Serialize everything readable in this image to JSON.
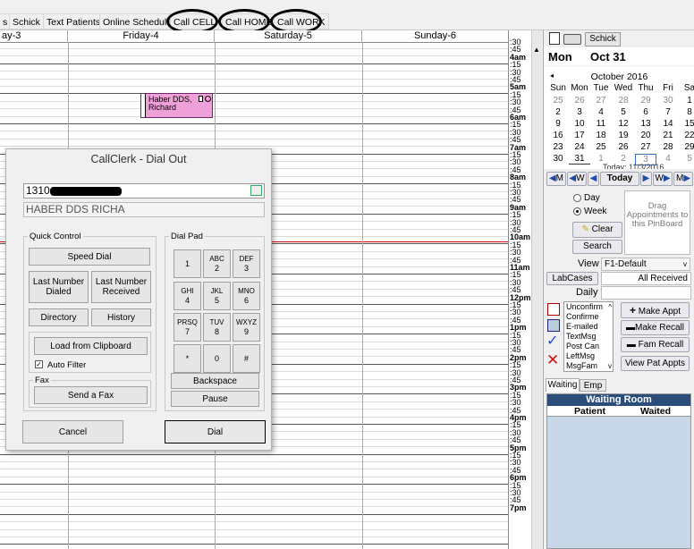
{
  "toolbar": {
    "items": [
      "s",
      "Schick",
      "Text Patients",
      "Online Schedule",
      "Call  CELL",
      "Call HOME",
      "Call WORK"
    ]
  },
  "days": [
    "ay-3",
    "Friday-4",
    "Saturday-5",
    "Sunday-6"
  ],
  "time_rows": [
    {
      "hour": "4am",
      "q": [
        ":15",
        ":30",
        ":45"
      ]
    },
    {
      "hour": "5am",
      "q": [
        ":15",
        ":30",
        ":45"
      ]
    },
    {
      "hour": "6am",
      "q": [
        ":15",
        ":30",
        ":45"
      ]
    },
    {
      "hour": "7am",
      "q": [
        ":15",
        ":30",
        ":45"
      ]
    },
    {
      "hour": "8am",
      "q": [
        ":15",
        ":30",
        ":45"
      ]
    },
    {
      "hour": "9am",
      "q": [
        ":15",
        ":30",
        ":45"
      ]
    },
    {
      "hour": "10am",
      "q": [
        ":15",
        ":30",
        ":45"
      ]
    },
    {
      "hour": "11am",
      "q": [
        ":15",
        ":30",
        ":45"
      ]
    },
    {
      "hour": "12pm",
      "q": [
        ":15",
        ":30",
        ":45"
      ]
    },
    {
      "hour": "1pm",
      "q": [
        ":15",
        ":30",
        ":45"
      ]
    },
    {
      "hour": "2pm",
      "q": [
        ":15",
        ":30",
        ":45"
      ]
    },
    {
      "hour": "3pm",
      "q": [
        ":15",
        ":30",
        ":45"
      ]
    },
    {
      "hour": "4pm",
      "q": [
        ":15",
        ":30",
        ":45"
      ]
    },
    {
      "hour": "5pm",
      "q": [
        ":15",
        ":30",
        ":45"
      ]
    },
    {
      "hour": "6pm",
      "q": [
        ":15",
        ":30",
        ":45"
      ]
    },
    {
      "hour": "7pm",
      "q": []
    }
  ],
  "time_top": [
    ":30",
    ":45"
  ],
  "appointment": {
    "line1": "Haber DDS,",
    "line2": "Richard",
    "color": "#f0a0d8"
  },
  "right_panel": {
    "provider_tab": "Schick",
    "date_day": "Mon",
    "date": "Oct 31",
    "month_title": "October 2016",
    "weekdays": [
      "Sun",
      "Mon",
      "Tue",
      "Wed",
      "Thu",
      "Fri",
      "Sa"
    ],
    "weeks": [
      [
        "25",
        "26",
        "27",
        "28",
        "29",
        "30",
        "1"
      ],
      [
        "2",
        "3",
        "4",
        "5",
        "6",
        "7",
        "8"
      ],
      [
        "9",
        "10",
        "11",
        "12",
        "13",
        "14",
        "15"
      ],
      [
        "16",
        "17",
        "18",
        "19",
        "20",
        "21",
        "22"
      ],
      [
        "23",
        "24",
        "25",
        "26",
        "27",
        "28",
        "29"
      ],
      [
        "30",
        "31",
        "1",
        "2",
        "3",
        "4",
        "5"
      ]
    ],
    "today_partial": "Today: 11/3/2016",
    "nav": {
      "m_back": "M",
      "w_back": "W",
      "today": "Today",
      "w_fwd": "W",
      "m_fwd": "M"
    },
    "view_day": "Day",
    "view_week": "Week",
    "clear": "Clear",
    "search": "Search",
    "pinboard": "Drag Appointments to this PinBoard",
    "view_label": "View",
    "view_value": "F1-Default",
    "labcases": "LabCases",
    "all_received": "All Received",
    "daily": "Daily",
    "status_list": [
      "Unconfirm",
      "Confirme",
      "E-mailed",
      "TextMsg",
      "Post Can",
      "LeftMsg",
      "MsgFam"
    ],
    "make_appt": "Make Appt",
    "make_recall": "Make Recall",
    "fam_recall": "Fam Recall",
    "view_pat_appts": "View Pat Appts",
    "tab_waiting": "Waiting",
    "tab_emp": "Emp",
    "waiting_room_title": "Waiting Room",
    "col_patient": "Patient",
    "col_waited": "Waited"
  },
  "dialog": {
    "title": "CallClerk - Dial Out",
    "number": "1310",
    "name": "HABER DDS RICHA",
    "quick_control": "Quick Control",
    "dial_pad": "Dial Pad",
    "speed_dial": "Speed Dial",
    "last_dialed": "Last Number Dialed",
    "last_received": "Last Number Received",
    "directory": "Directory",
    "history": "History",
    "load_clipboard": "Load from Clipboard",
    "auto_filter": "Auto Filter",
    "fax": "Fax",
    "send_fax": "Send a Fax",
    "backspace": "Backspace",
    "pause": "Pause",
    "cancel": "Cancel",
    "dial": "Dial",
    "keys": [
      {
        "l": "",
        "n": "1"
      },
      {
        "l": "ABC",
        "n": "2"
      },
      {
        "l": "DEF",
        "n": "3"
      },
      {
        "l": "GHI",
        "n": "4"
      },
      {
        "l": "JKL",
        "n": "5"
      },
      {
        "l": "MNO",
        "n": "6"
      },
      {
        "l": "PRSQ",
        "n": "7"
      },
      {
        "l": "TUV",
        "n": "8"
      },
      {
        "l": "WXYZ",
        "n": "9"
      },
      {
        "l": "",
        "n": "*"
      },
      {
        "l": "",
        "n": "0"
      },
      {
        "l": "",
        "n": "#"
      }
    ]
  }
}
